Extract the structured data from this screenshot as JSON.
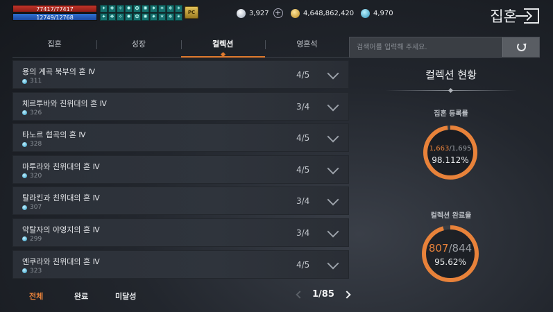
{
  "hud": {
    "hp_text": "77417/77417",
    "mp_text": "12749/12768",
    "hp_fraction": 1.0,
    "mp_fraction": 0.9985,
    "pc_badge": "PC",
    "buffs": [
      "buff-icon",
      "buff-icon",
      "buff-icon",
      "buff-icon",
      "buff-icon",
      "buff-icon",
      "buff-icon",
      "buff-icon",
      "buff-icon",
      "buff-icon",
      "buff-icon",
      "buff-icon",
      "buff-icon",
      "buff-icon",
      "buff-icon",
      "buff-icon",
      "buff-icon",
      "buff-icon",
      "buff-icon",
      "buff-icon"
    ]
  },
  "currencies": {
    "diamond": "3,927",
    "gold": "4,648,862,420",
    "gem": "4,970"
  },
  "window_title": "집혼",
  "tabs": [
    {
      "label": "집혼",
      "active": false
    },
    {
      "label": "성장",
      "active": false
    },
    {
      "label": "컬렉션",
      "active": true
    },
    {
      "label": "영혼석",
      "active": false
    }
  ],
  "collections": [
    {
      "name": "용의 계곡 북부의 혼 Ⅳ",
      "points": "311",
      "progress": "4/5"
    },
    {
      "name": "체르투바와 친위대의 혼 Ⅳ",
      "points": "326",
      "progress": "3/4"
    },
    {
      "name": "타노르 협곡의 혼 Ⅳ",
      "points": "328",
      "progress": "4/5"
    },
    {
      "name": "마투라와 친위대의 혼 Ⅳ",
      "points": "320",
      "progress": "4/5"
    },
    {
      "name": "탈라킨과 친위대의 혼 Ⅳ",
      "points": "307",
      "progress": "3/4"
    },
    {
      "name": "악탈자의 야영지의 혼 Ⅳ",
      "points": "299",
      "progress": "3/4"
    },
    {
      "name": "엔쿠라와 친위대의 혼 Ⅳ",
      "points": "323",
      "progress": "4/5"
    }
  ],
  "filters": [
    {
      "label": "전체",
      "active": true
    },
    {
      "label": "완료",
      "active": false
    },
    {
      "label": "미달성",
      "active": false
    }
  ],
  "pager": {
    "text": "1/85"
  },
  "search": {
    "placeholder": "검색어를 입력해 주세요."
  },
  "panel": {
    "title": "컬렉션 현황",
    "registration": {
      "label": "집혼 등록률",
      "current": "1,663",
      "total": "/1,695",
      "percent": "98.112%",
      "fraction": 0.98112
    },
    "completion": {
      "label": "컬렉션 완료율",
      "current": "807",
      "total": "/844",
      "percent": "95.62%",
      "fraction": 0.9562
    }
  },
  "colors": {
    "accent": "#e8823a",
    "ring_track": "#3a3d42"
  }
}
